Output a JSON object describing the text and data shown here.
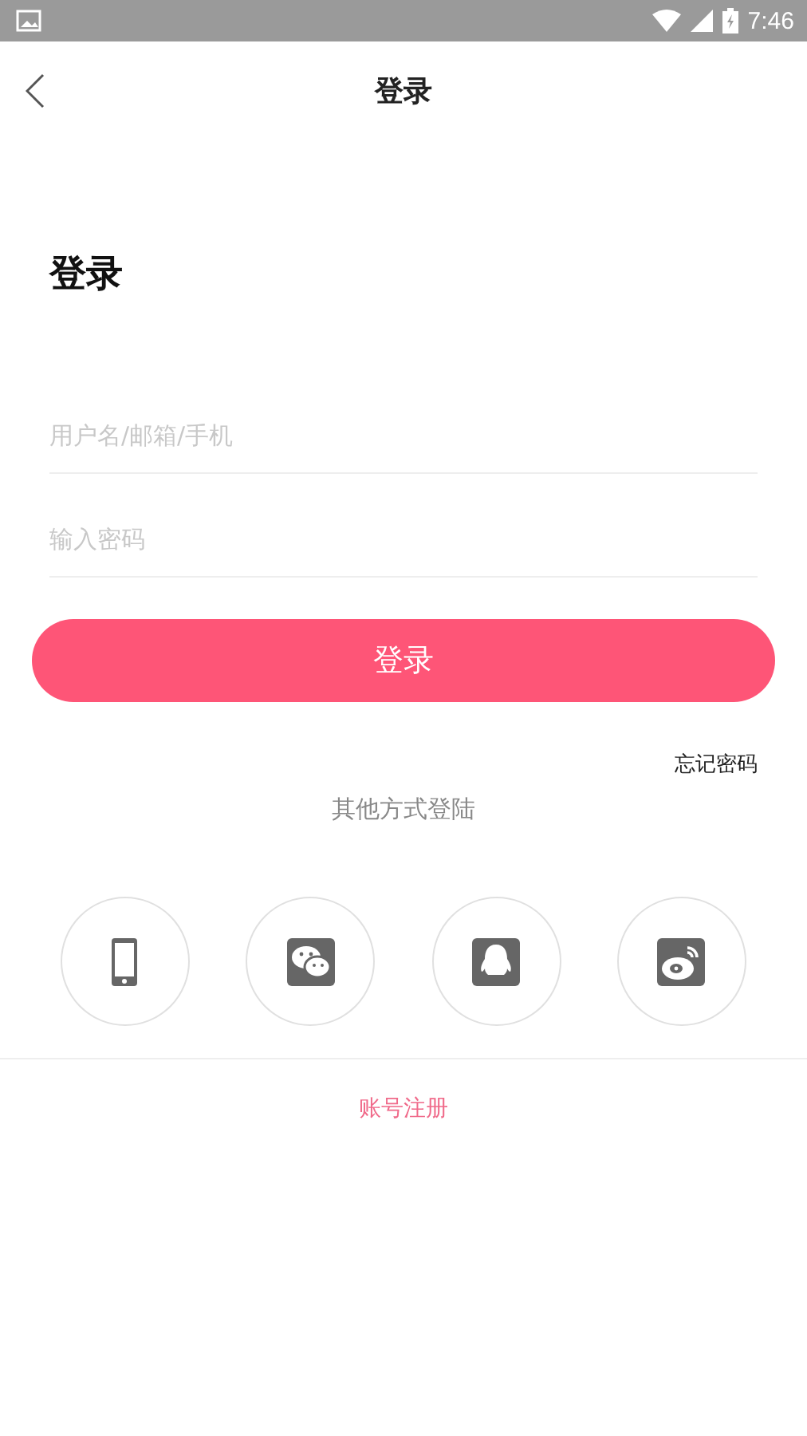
{
  "status_bar": {
    "time": "7:46"
  },
  "header": {
    "title": "登录"
  },
  "heading": "登录",
  "fields": [
    {
      "placeholder": "用户名/邮箱/手机"
    },
    {
      "placeholder": "输入密码"
    }
  ],
  "login_button": "登录",
  "forgot_password": "忘记密码",
  "other_methods": "其他方式登陆",
  "social": [
    {
      "kind": "phone"
    },
    {
      "kind": "wechat"
    },
    {
      "kind": "qq"
    },
    {
      "kind": "weibo"
    }
  ],
  "register_link": "账号注册"
}
